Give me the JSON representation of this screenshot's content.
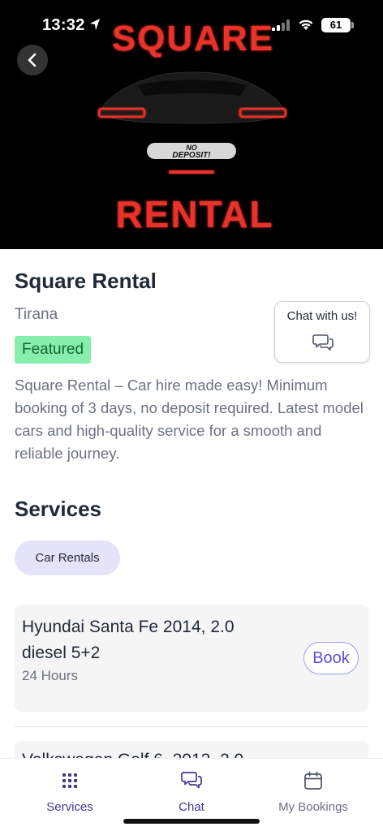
{
  "status_bar": {
    "time": "13:32",
    "battery": "61"
  },
  "hero": {
    "title_top": "SQUARE",
    "title_bottom": "RENTAL",
    "plate_line1": "NO",
    "plate_line2": "DEPOSIT!",
    "back_icon": "chevron-left-icon",
    "colors": {
      "background": "#000000",
      "neon": "#e8302b"
    }
  },
  "business": {
    "name": "Square Rental",
    "city": "Tirana",
    "badge": "Featured",
    "description": "Square Rental – Car hire made easy! Minimum booking of 3 days, no deposit required. Latest model cars and high-quality service for a smooth and reliable journey.",
    "chat_label": "Chat with us!",
    "chat_icon": "chat-bubbles-icon"
  },
  "services": {
    "title": "Services",
    "category": "Car Rentals",
    "items": [
      {
        "name": "Hyundai Santa Fe 2014, 2.0 diesel 5+2",
        "duration": "24 Hours",
        "action": "Book"
      },
      {
        "name": "Volkswagen Golf 6, 2012, 2.0"
      }
    ]
  },
  "tab_bar": {
    "items": [
      {
        "label": "Services",
        "icon": "grid-icon",
        "active": true
      },
      {
        "label": "Chat",
        "icon": "chat-bubbles-icon",
        "active": false
      },
      {
        "label": "My Bookings",
        "icon": "calendar-icon",
        "active": false
      }
    ],
    "colors": {
      "active": "#3f3a8f",
      "inactive": "#6b7280"
    }
  },
  "colors": {
    "accent": "#5b4fcf",
    "badge_bg": "#86efac",
    "chip_bg": "#e4e3fa"
  }
}
